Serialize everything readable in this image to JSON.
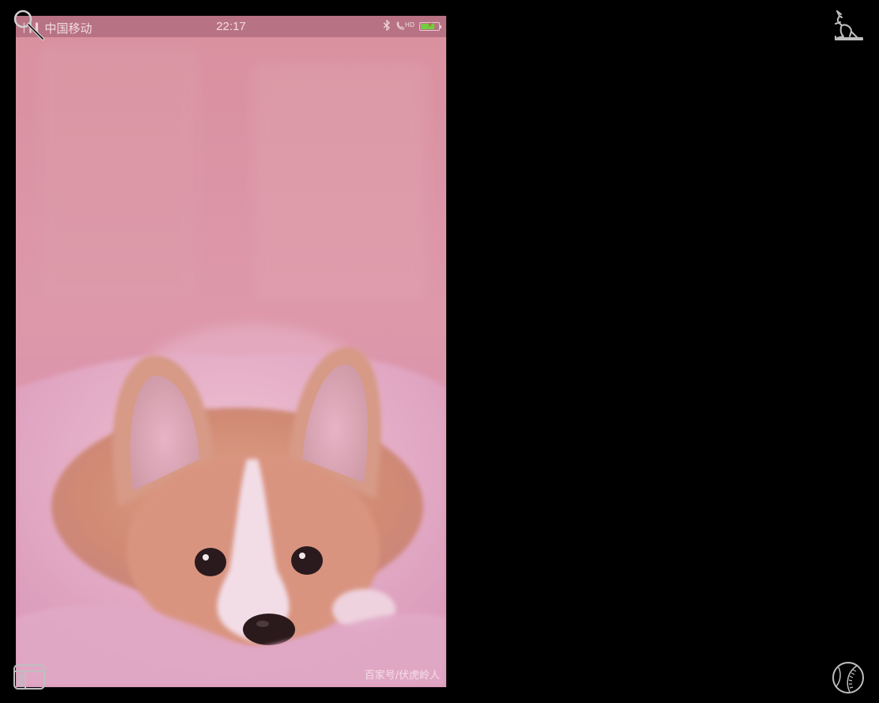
{
  "status_bar": {
    "signal": "▏▎▍",
    "carrier": "中国移动",
    "time": "22:17",
    "bluetooth_icon": "bluetooth-icon",
    "volte_icon": "hd-call-icon",
    "hd_label": "HD",
    "battery_icon": "battery-charging-icon",
    "battery_level": 0.7
  },
  "wallpaper": {
    "subject": "corgi-puppy-photo",
    "watermark": "百家号/伏虎岭人"
  },
  "overlay_icons": {
    "top_left": "magnifier-icon",
    "top_right": "kangaroo-icon",
    "bottom_left": "window-panel-icon",
    "bottom_right": "baseball-icon"
  },
  "colors": {
    "background": "#000000",
    "wallpaper_tint": "#d88fa6",
    "status_text": "#f3dbe3",
    "battery_fill": "#6fcf3d"
  }
}
